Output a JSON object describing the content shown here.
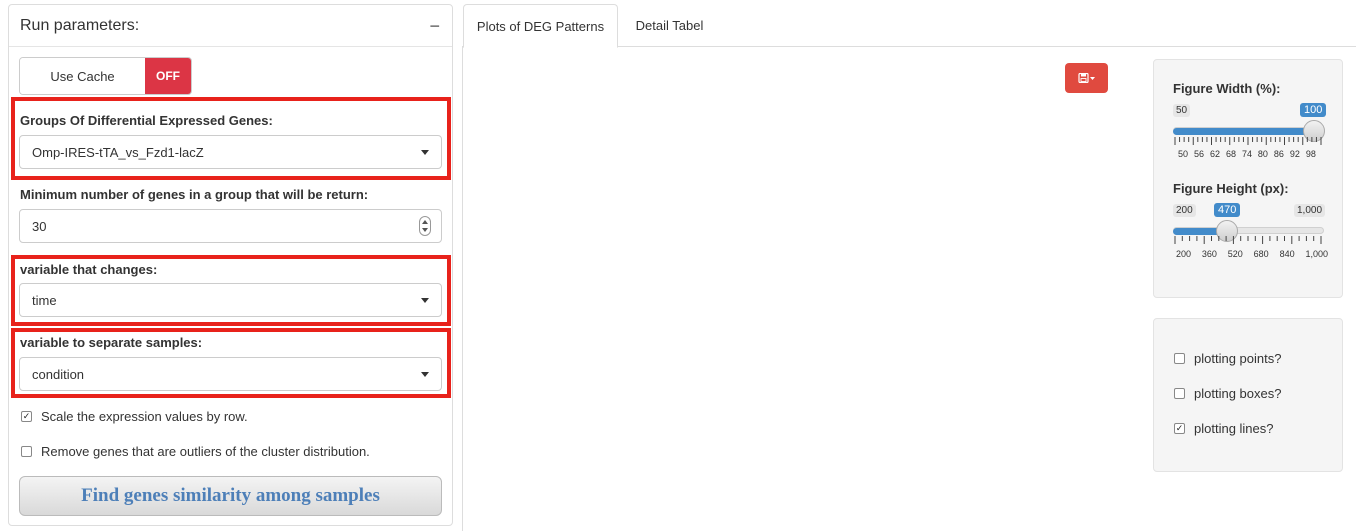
{
  "left_panel": {
    "title": "Run parameters:",
    "collapse_label": "−",
    "use_cache": {
      "label": "Use Cache",
      "state": "OFF"
    },
    "groups_deg": {
      "label": "Groups Of Differential Expressed Genes:",
      "value": "Omp-IRES-tTA_vs_Fzd1-lacZ"
    },
    "min_genes": {
      "label": "Minimum number of genes in a group that will be return:",
      "value": "30"
    },
    "variable_changes": {
      "label": "variable that changes:",
      "value": "time"
    },
    "variable_separate": {
      "label": "variable to separate samples:",
      "value": "condition"
    },
    "scale_checkbox": {
      "label": "Scale the expression values by row.",
      "checked": true
    },
    "outliers_checkbox": {
      "label": "Remove genes that are outliers of the cluster distribution.",
      "checked": false
    },
    "find_button": "Find genes similarity among samples"
  },
  "tabs": [
    {
      "label": "Plots of DEG Patterns",
      "active": true
    },
    {
      "label": "Detail Tabel",
      "active": false
    }
  ],
  "download_icon": "save-icon",
  "figure_width": {
    "label": "Figure Width (%):",
    "min": "50",
    "max": "100",
    "value": "100",
    "ticks": [
      "50",
      "56",
      "62",
      "68",
      "74",
      "80",
      "86",
      "92",
      "98"
    ]
  },
  "figure_height": {
    "label": "Figure Height (px):",
    "min": "200",
    "max": "1,000",
    "value": "470",
    "ticks": [
      "200",
      "360",
      "520",
      "680",
      "840",
      "1,000"
    ]
  },
  "plot_options": [
    {
      "label": "plotting points?",
      "checked": false
    },
    {
      "label": "plotting boxes?",
      "checked": false
    },
    {
      "label": "plotting lines?",
      "checked": true
    }
  ],
  "colors": {
    "off": "#dc3545",
    "highlight_box": "#e8221b",
    "slider": "#428bca",
    "download": "#e04a3f"
  }
}
